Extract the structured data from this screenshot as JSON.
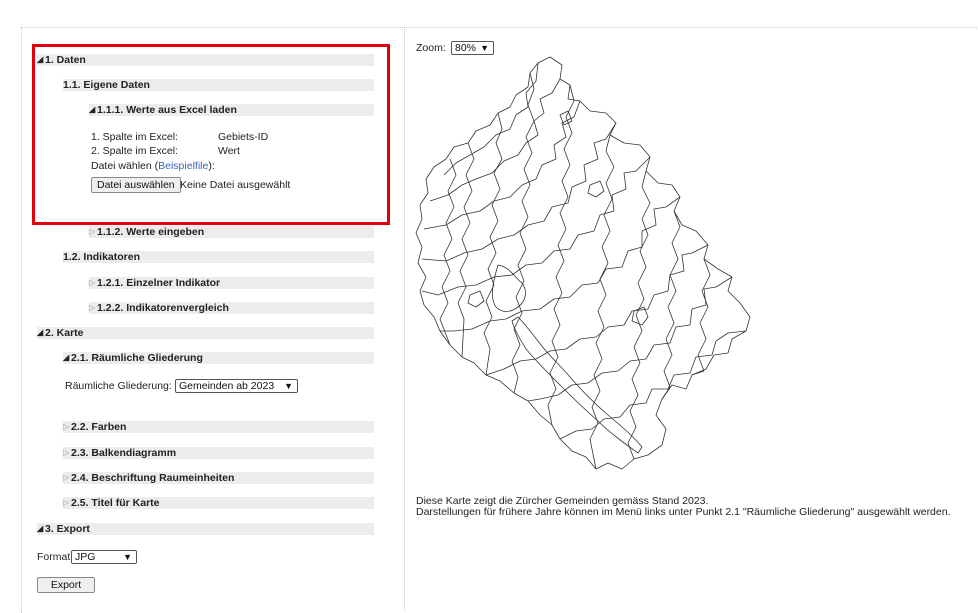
{
  "menu": {
    "s1": {
      "label": "1. Daten"
    },
    "s11": {
      "label": "1.1. Eigene Daten"
    },
    "s111": {
      "label": "1.1.1. Werte aus Excel laden",
      "col1_label": "1. Spalte im Excel:",
      "col1_value": "Gebiets-ID",
      "col2_label": "2. Spalte im Excel:",
      "col2_value": "Wert",
      "file_prefix": "Datei wählen (",
      "file_link": "Beispielfile",
      "file_suffix": "):",
      "file_button": "Datei auswählen",
      "file_status": "Keine Datei ausgewählt"
    },
    "s112": {
      "label": "1.1.2. Werte eingeben"
    },
    "s12": {
      "label": "1.2. Indikatoren"
    },
    "s121": {
      "label": "1.2.1. Einzelner Indikator"
    },
    "s122": {
      "label": "1.2.2. Indikatorenvergleich"
    },
    "s2": {
      "label": "2. Karte"
    },
    "s21": {
      "label": "2.1. Räumliche Gliederung",
      "field_label": "Räumliche Gliederung:",
      "selected": "Gemeinden ab 2023"
    },
    "s22": {
      "label": "2.2. Farben"
    },
    "s23": {
      "label": "2.3. Balkendiagramm"
    },
    "s24": {
      "label": "2.4. Beschriftung Raumeinheiten"
    },
    "s25": {
      "label": "2.5. Titel für Karte"
    },
    "s3": {
      "label": "3. Export",
      "format_label": "Format:",
      "format_selected": "JPG",
      "export_button": "Export"
    }
  },
  "map": {
    "zoom_label": "Zoom:",
    "zoom_selected": "80%",
    "caption_line1": "Diese Karte zeigt die Zürcher Gemeinden gemäss Stand 2023.",
    "caption_line2": "Darstellungen für frühere Jahre können im Menü links unter Punkt 2.1 \"Räumliche Gliederung\" ausgewählt werden."
  },
  "colors": {
    "highlight_box": "#e3000b",
    "section_bar": "#ececec",
    "link": "#3a63b8"
  }
}
